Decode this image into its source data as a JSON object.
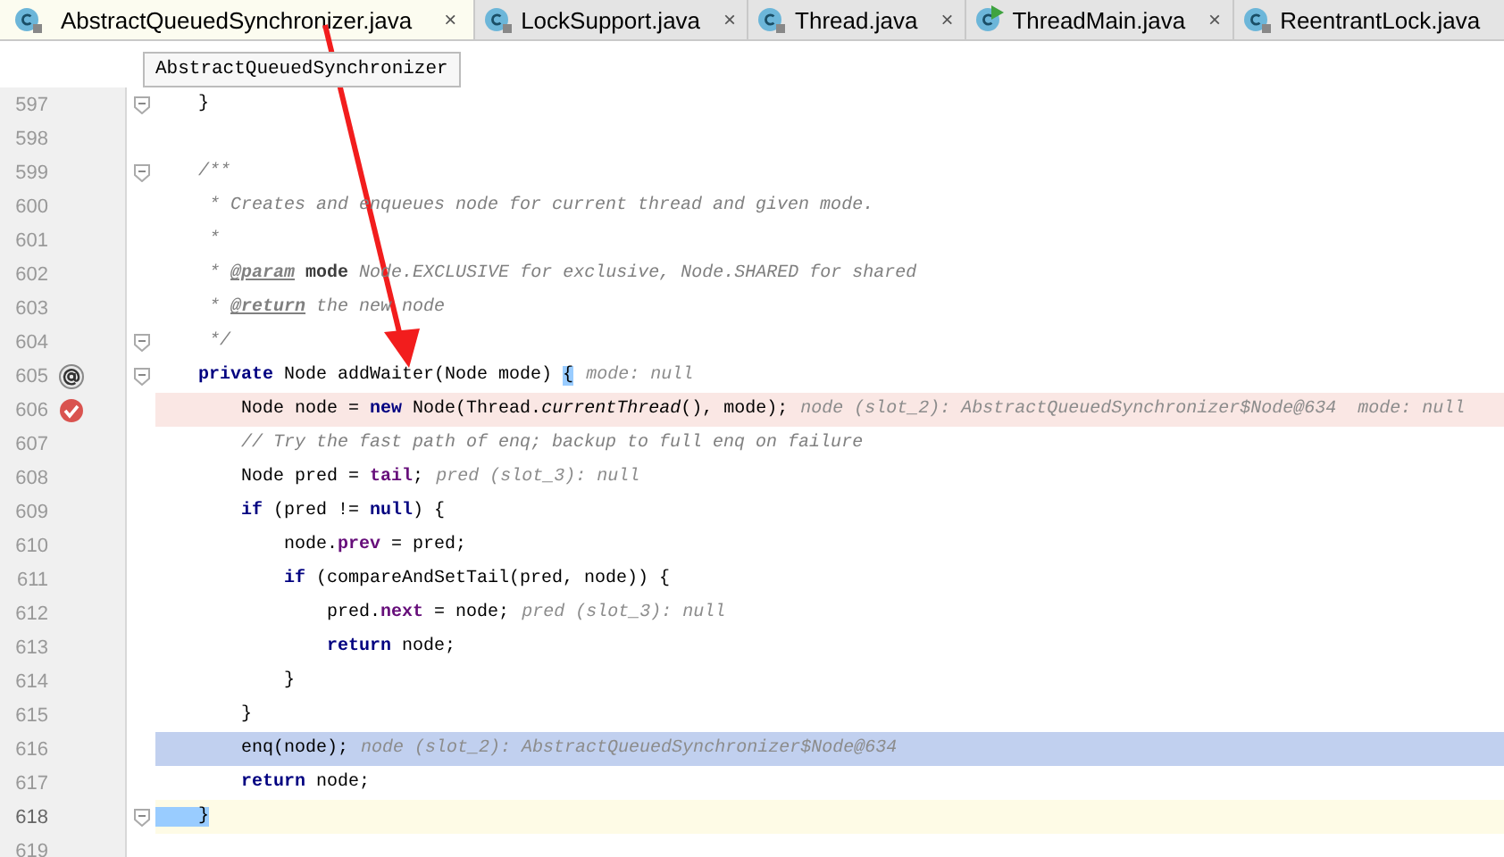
{
  "tabs": [
    {
      "label": "AbstractQueuedSynchronizer.java",
      "kind": "class",
      "selected": true
    },
    {
      "label": "LockSupport.java",
      "kind": "class",
      "selected": false
    },
    {
      "label": "Thread.java",
      "kind": "class",
      "selected": false
    },
    {
      "label": "ThreadMain.java",
      "kind": "runnable",
      "selected": false
    },
    {
      "label": "ReentrantLock.java",
      "kind": "class",
      "selected": false
    }
  ],
  "tab_close": "×",
  "tooltip": "AbstractQueuedSynchronizer",
  "lines": [
    {
      "number": "597",
      "kind": "plain",
      "fold": true,
      "tokens": [
        {
          "t": "    }",
          "kind": "plain"
        }
      ]
    },
    {
      "number": "598",
      "kind": "plain",
      "fold": false
    },
    {
      "number": "599",
      "kind": "plain",
      "fold": true,
      "tokens": [
        {
          "t": "    /**",
          "kind": "comment"
        }
      ]
    },
    {
      "number": "600",
      "kind": "plain",
      "fold": false,
      "tokens": [
        {
          "t": "     * Creates and enqueues node for current thread and given mode.",
          "kind": "comment"
        }
      ]
    },
    {
      "number": "601",
      "kind": "plain",
      "fold": false,
      "tokens": [
        {
          "t": "     *",
          "kind": "comment"
        }
      ]
    },
    {
      "number": "602",
      "kind": "plain",
      "fold": false,
      "tokens": [
        {
          "t": "     * ",
          "kind": "comment"
        },
        {
          "t": "@param",
          "kind": "doctag"
        },
        {
          "t": " mode",
          "kind": "docparam"
        },
        {
          "t": " Node.EXCLUSIVE for exclusive, Node.SHARED for shared",
          "kind": "comment"
        }
      ]
    },
    {
      "number": "603",
      "kind": "plain",
      "fold": false,
      "tokens": [
        {
          "t": "     * ",
          "kind": "comment"
        },
        {
          "t": "@return",
          "kind": "doctag"
        },
        {
          "t": " the new node",
          "kind": "comment"
        }
      ]
    },
    {
      "number": "604",
      "kind": "plain",
      "fold": true,
      "tokens": [
        {
          "t": "     */",
          "kind": "comment"
        }
      ]
    },
    {
      "number": "605",
      "kind": "override",
      "fold": true,
      "tokens": [
        {
          "t": "    private",
          "kind": "kw"
        },
        {
          "t": " Node addWaiter(Node mode) ",
          "kind": "plain"
        },
        {
          "t": "{",
          "kind": "brace"
        }
      ],
      "hint": "mode: null"
    },
    {
      "number": "606",
      "kind": "breakpoint",
      "fold": false,
      "tokens": [
        {
          "t": "        Node node = ",
          "kind": "plain"
        },
        {
          "t": "new",
          "kind": "kw"
        },
        {
          "t": " Node(Thread.",
          "kind": "plain"
        },
        {
          "t": "currentThread",
          "kind": "static"
        },
        {
          "t": "(), mode);",
          "kind": "plain"
        }
      ],
      "hint": "node (slot_2): AbstractQueuedSynchronizer$Node@634  mode: null"
    },
    {
      "number": "607",
      "kind": "plain",
      "fold": false,
      "tokens": [
        {
          "t": "        // Try the fast path of enq; backup to full enq on failure",
          "kind": "comment"
        }
      ]
    },
    {
      "number": "608",
      "kind": "plain",
      "fold": false,
      "tokens": [
        {
          "t": "        Node pred = ",
          "kind": "plain"
        },
        {
          "t": "tail",
          "kind": "field"
        },
        {
          "t": ";",
          "kind": "plain"
        }
      ],
      "hint": "pred (slot_3): null"
    },
    {
      "number": "609",
      "kind": "plain",
      "fold": false,
      "tokens": [
        {
          "t": "        if",
          "kind": "kw"
        },
        {
          "t": " (pred != ",
          "kind": "plain"
        },
        {
          "t": "null",
          "kind": "kw"
        },
        {
          "t": ") {",
          "kind": "plain"
        }
      ]
    },
    {
      "number": "610",
      "kind": "plain",
      "fold": false,
      "tokens": [
        {
          "t": "            node.",
          "kind": "plain"
        },
        {
          "t": "prev",
          "kind": "field"
        },
        {
          "t": " = pred;",
          "kind": "plain"
        }
      ]
    },
    {
      "number": "611",
      "kind": "plain",
      "fold": false,
      "tokens": [
        {
          "t": "            if",
          "kind": "kw"
        },
        {
          "t": " (compareAndSetTail(pred, node)) {",
          "kind": "plain"
        }
      ]
    },
    {
      "number": "612",
      "kind": "plain",
      "fold": false,
      "tokens": [
        {
          "t": "                pred.",
          "kind": "plain"
        },
        {
          "t": "next",
          "kind": "field"
        },
        {
          "t": " = node;",
          "kind": "plain"
        }
      ],
      "hint": "pred (slot_3): null"
    },
    {
      "number": "613",
      "kind": "plain",
      "fold": false,
      "tokens": [
        {
          "t": "                return",
          "kind": "kw"
        },
        {
          "t": " node;",
          "kind": "plain"
        }
      ]
    },
    {
      "number": "614",
      "kind": "plain",
      "fold": false,
      "tokens": [
        {
          "t": "            }",
          "kind": "plain"
        }
      ]
    },
    {
      "number": "615",
      "kind": "plain",
      "fold": false,
      "tokens": [
        {
          "t": "        }",
          "kind": "plain"
        }
      ]
    },
    {
      "number": "616",
      "kind": "execution",
      "fold": false,
      "tokens": [
        {
          "t": "        enq(node);",
          "kind": "plain"
        }
      ],
      "hint": "node (slot_2): AbstractQueuedSynchronizer$Node@634"
    },
    {
      "number": "617",
      "kind": "plain",
      "fold": false,
      "tokens": [
        {
          "t": "        return",
          "kind": "kw"
        },
        {
          "t": " node;",
          "kind": "plain"
        }
      ]
    },
    {
      "number": "618",
      "kind": "caret",
      "fold": true,
      "tokens": [
        {
          "t": "    }",
          "kind": "brace"
        }
      ]
    },
    {
      "number": "619",
      "kind": "plain",
      "fold": false
    }
  ]
}
